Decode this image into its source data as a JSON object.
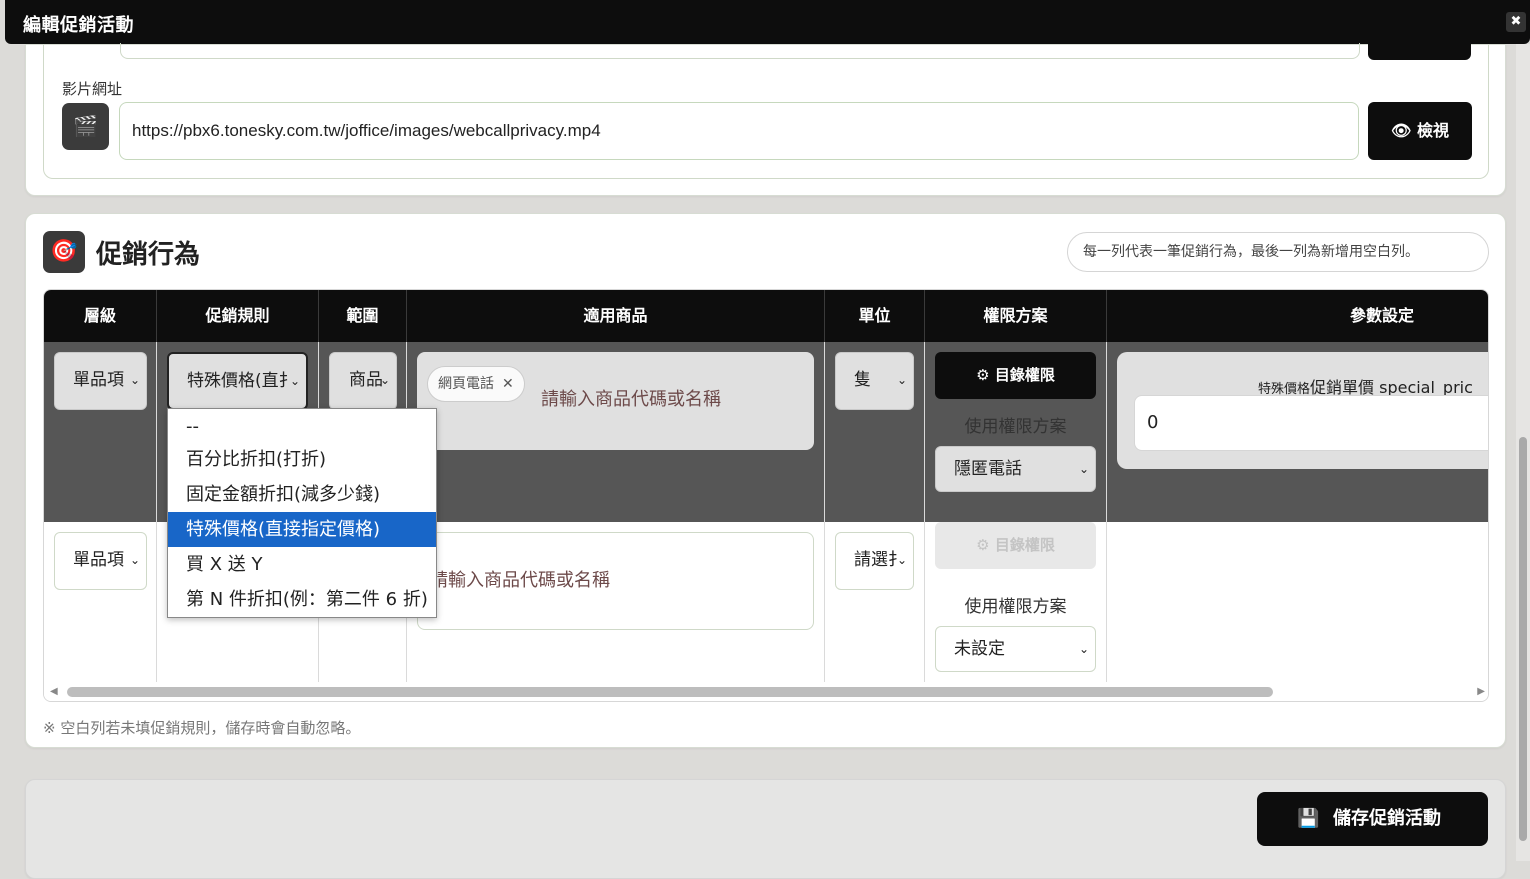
{
  "window": {
    "title": "編輯促銷活動",
    "close_glyph": "✖"
  },
  "media": {
    "video_label": "影片網址",
    "video_icon": "clapperboard-icon",
    "video_url": "https://pbx6.tonesky.com.tw/joffice/images/webcallprivacy.mp4",
    "view_button": "檢視"
  },
  "section": {
    "title": "促銷行為",
    "hint": "每一列代表一筆促銷行為，最後一列為新增用空白列。",
    "columns": [
      "層級",
      "促銷規則",
      "範圍",
      "適用商品",
      "單位",
      "權限方案",
      "參數設定"
    ],
    "note": "※ 空白列若未填促銷規則，儲存時會自動忽略。"
  },
  "rows": [
    {
      "level": "單品項",
      "rule": "特殊價格(直扌",
      "scope": "商品",
      "product_chip": "網頁電話",
      "product_placeholder": "請輸入商品代碼或名稱",
      "unit": "隻",
      "perm_button": "目錄權限",
      "perm_label": "使用權限方案",
      "perm_value": "隱匿電話",
      "param_label_prefix": "特殊價格",
      "param_label_main": "促銷單價 special_pric",
      "param_value": "0"
    },
    {
      "level": "單品項",
      "product_placeholder": "請輸入商品代碼或名稱",
      "unit": "請選扌",
      "perm_button": "目錄權限",
      "perm_label": "使用權限方案",
      "perm_value": "未設定"
    }
  ],
  "rule_dropdown": {
    "options": [
      "--",
      "百分比折扣(打折)",
      "固定金額折扣(減多少錢)",
      "特殊價格(直接指定價格)",
      "買 X 送 Y",
      "第 N 件折扣(例：第二件 6 折)"
    ],
    "selected_index": 3
  },
  "footer": {
    "save_button": "儲存促銷活動"
  }
}
